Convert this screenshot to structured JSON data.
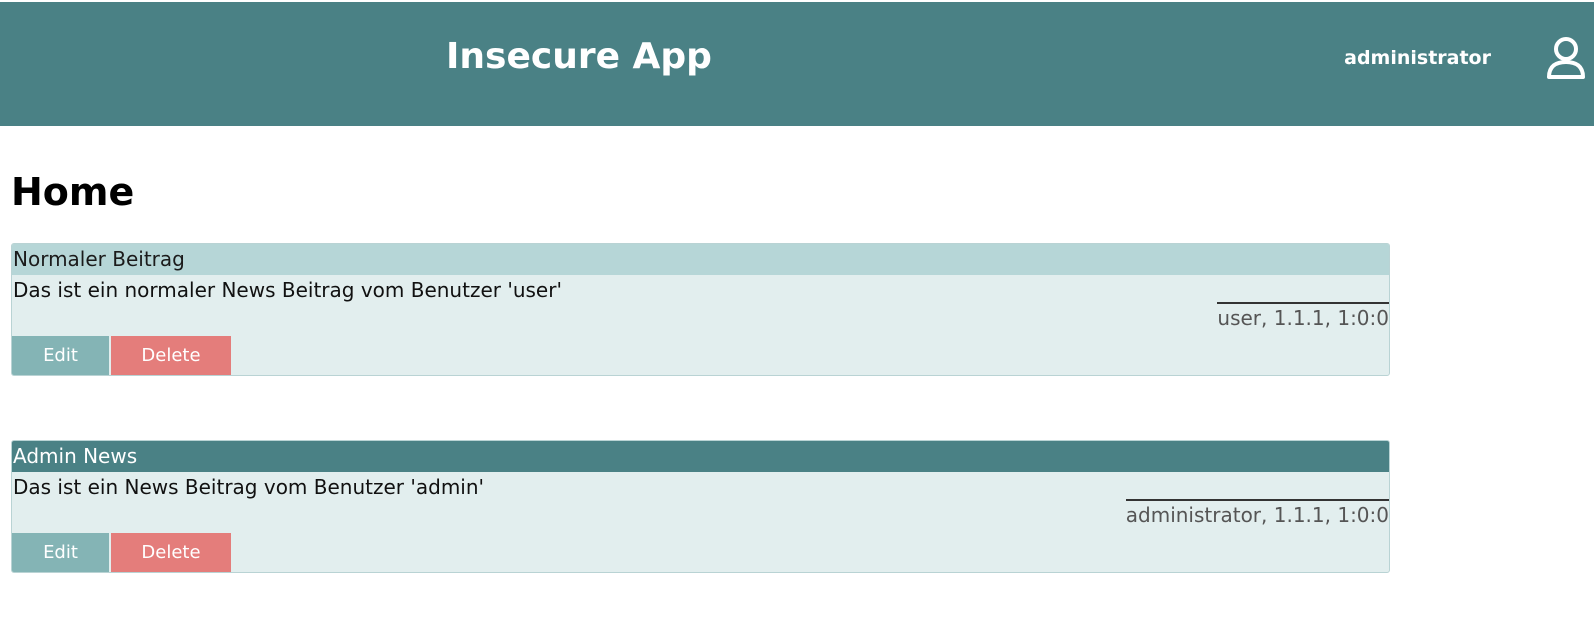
{
  "header": {
    "app_title": "Insecure App",
    "username": "administrator",
    "user_icon": "user-icon"
  },
  "main": {
    "page_title": "Home",
    "posts": [
      {
        "title": "Normaler Beitrag",
        "body": "Das ist ein normaler News Beitrag vom Benutzer 'user'",
        "meta": "user, 1.1.1, 1:0:0",
        "edit_label": "Edit",
        "delete_label": "Delete",
        "style": "normal"
      },
      {
        "title": "Admin News",
        "body": "Das ist ein News Beitrag vom Benutzer 'admin'",
        "meta": "administrator, 1.1.1, 1:0:0",
        "edit_label": "Edit",
        "delete_label": "Delete",
        "style": "admin"
      }
    ]
  },
  "colors": {
    "header_bg": "#4a8185",
    "card_bg": "#e2eeee",
    "card_head_normal": "#b6d6d7",
    "card_head_admin": "#4a8185",
    "edit_button": "#84b4b5",
    "delete_button": "#e47d7b"
  }
}
